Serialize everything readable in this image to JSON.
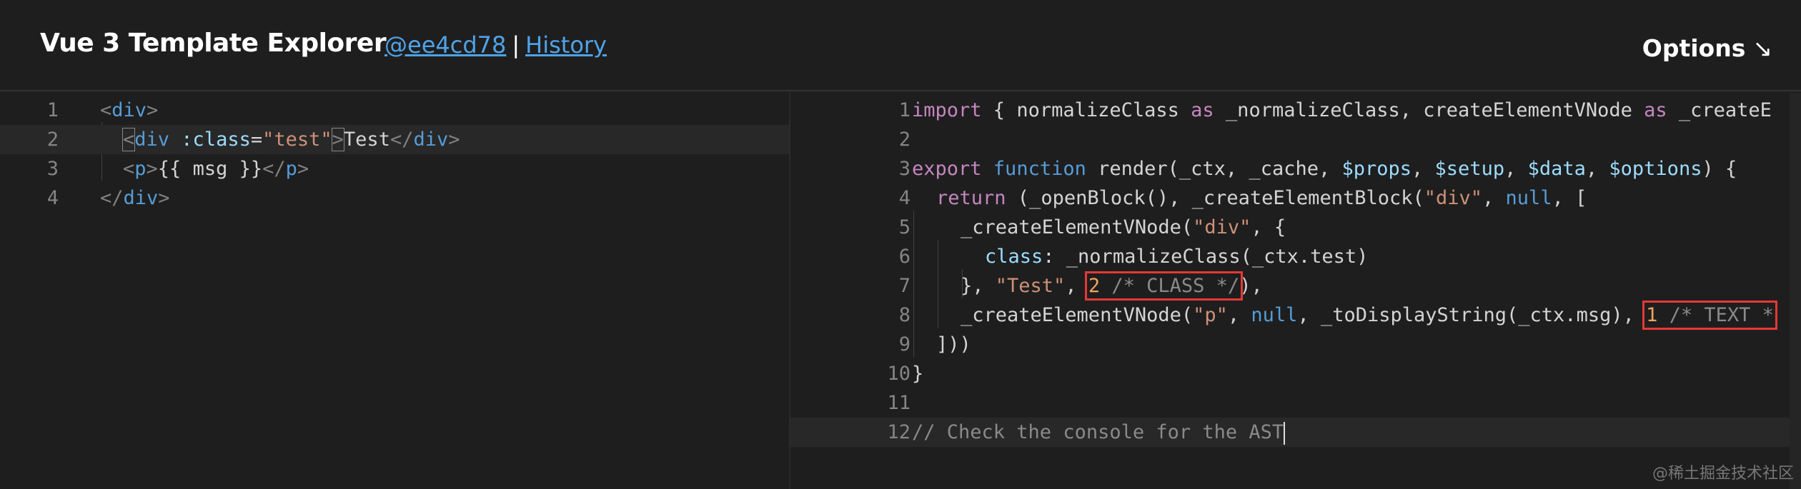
{
  "header": {
    "title": "Vue 3 Template Explorer",
    "commit_link": "@ee4cd78",
    "separator": "|",
    "history_link": "History",
    "options_label": "Options",
    "options_arrow": "↘"
  },
  "left_editor": {
    "lines": [
      {
        "num": "1"
      },
      {
        "num": "2"
      },
      {
        "num": "3"
      },
      {
        "num": "4"
      }
    ],
    "tokens": {
      "l1_open": "<",
      "l1_tag": "div",
      "l1_close": ">",
      "l2_open": "<",
      "l2_tag": "div",
      "l2_attr": " :class",
      "l2_eq": "=",
      "l2_str": "\"test\"",
      "l2_close": ">",
      "l2_text": "Test",
      "l2_end_open": "</",
      "l2_end_tag": "div",
      "l2_end_close": ">",
      "l3_open": "<",
      "l3_tag": "p",
      "l3_close": ">",
      "l3_text": "{{ msg }}",
      "l3_end_open": "</",
      "l3_end_tag": "p",
      "l3_end_close": ">",
      "l4_open": "</",
      "l4_tag": "div",
      "l4_close": ">"
    }
  },
  "right_editor": {
    "lines": [
      {
        "num": "1"
      },
      {
        "num": "2"
      },
      {
        "num": "3"
      },
      {
        "num": "4"
      },
      {
        "num": "5"
      },
      {
        "num": "6"
      },
      {
        "num": "7"
      },
      {
        "num": "8"
      },
      {
        "num": "9"
      },
      {
        "num": "10"
      },
      {
        "num": "11"
      },
      {
        "num": "12"
      }
    ],
    "tokens": {
      "l1_kw": "import",
      "l1_rest": " { normalizeClass ",
      "l1_as1": "as",
      "l1_rest2": " _normalizeClass, createElementVNode ",
      "l1_as2": "as",
      "l1_rest3": " _createE",
      "l3_kw": "export",
      "l3_fn": " function",
      "l3_rest": " render(_ctx, _cache, ",
      "l3_p1": "$props",
      "l3_c1": ", ",
      "l3_p2": "$setup",
      "l3_c2": ", ",
      "l3_p3": "$data",
      "l3_c3": ", ",
      "l3_p4": "$options",
      "l3_end": ") {",
      "l4_kw": "return",
      "l4_rest": " (_openBlock(), _createElementBlock(",
      "l4_str": "\"div\"",
      "l4_c": ", ",
      "l4_null": "null",
      "l4_end": ", [",
      "l5_rest": "_createElementVNode(",
      "l5_str": "\"div\"",
      "l5_end": ", {",
      "l6_prop": "class",
      "l6_rest": ": _normalizeClass(_ctx.test)",
      "l7_rest": "}, ",
      "l7_str": "\"Test\"",
      "l7_c": ", ",
      "l7_num": "2",
      "l7_com": " /* CLASS */",
      "l7_end": "),",
      "l8_rest": "_createElementVNode(",
      "l8_str": "\"p\"",
      "l8_c": ", ",
      "l8_null": "null",
      "l8_rest2": ", _toDisplayString(_ctx.msg), ",
      "l8_num": "1",
      "l8_com": " /* TEXT *",
      "l9_rest": "]))",
      "l10_rest": "}",
      "l12_com": "// Check the console for the AST"
    }
  },
  "watermark": "@稀土掘金技术社区",
  "colors": {
    "background": "#1e1e1e",
    "link": "#4fa3e8",
    "highlight_box": "#e53935",
    "keyword": "#c586c0",
    "string": "#ce9178",
    "number": "#f0a35e"
  }
}
